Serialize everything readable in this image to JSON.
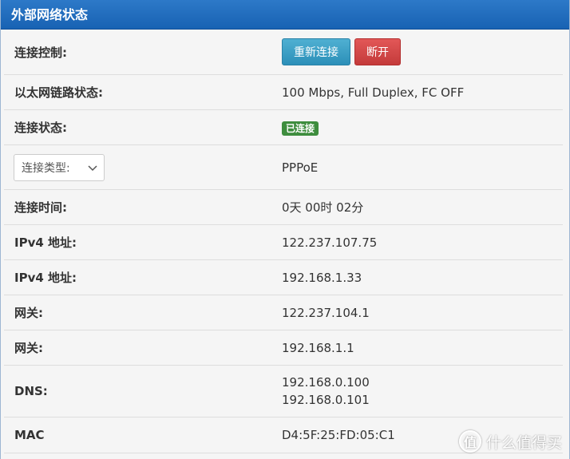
{
  "panel": {
    "title": "外部网络状态"
  },
  "rows": {
    "control": {
      "label": "连接控制:",
      "reconnect_label": "重新连接",
      "disconnect_label": "断开"
    },
    "link": {
      "label": "以太网链路状态:",
      "value": "100 Mbps, Full Duplex, FC OFF"
    },
    "status": {
      "label": "连接状态:",
      "badge": "已连接",
      "badge_color": "#3e8d3e"
    },
    "type": {
      "select_value": "连接类型:",
      "value": "PPPoE"
    },
    "time": {
      "label": "连接时间:",
      "value": "0天 00时 02分"
    },
    "ipv4_1": {
      "label": "IPv4 地址:",
      "value": "122.237.107.75"
    },
    "ipv4_2": {
      "label": "IPv4 地址:",
      "value": "192.168.1.33"
    },
    "gateway_1": {
      "label": "网关:",
      "value": "122.237.104.1"
    },
    "gateway_2": {
      "label": "网关:",
      "value": "192.168.1.1"
    },
    "dns": {
      "label": "DNS:",
      "values": [
        "192.168.0.100",
        "192.168.0.101"
      ]
    },
    "mac": {
      "label": "MAC",
      "value": "D4:5F:25:FD:05:C1"
    }
  },
  "watermark": {
    "logo_char": "值",
    "text": "什么值得买"
  },
  "colors": {
    "header": "#1862b3",
    "reconnect_button": "#2c8fb8",
    "disconnect_button": "#c43b3b"
  }
}
